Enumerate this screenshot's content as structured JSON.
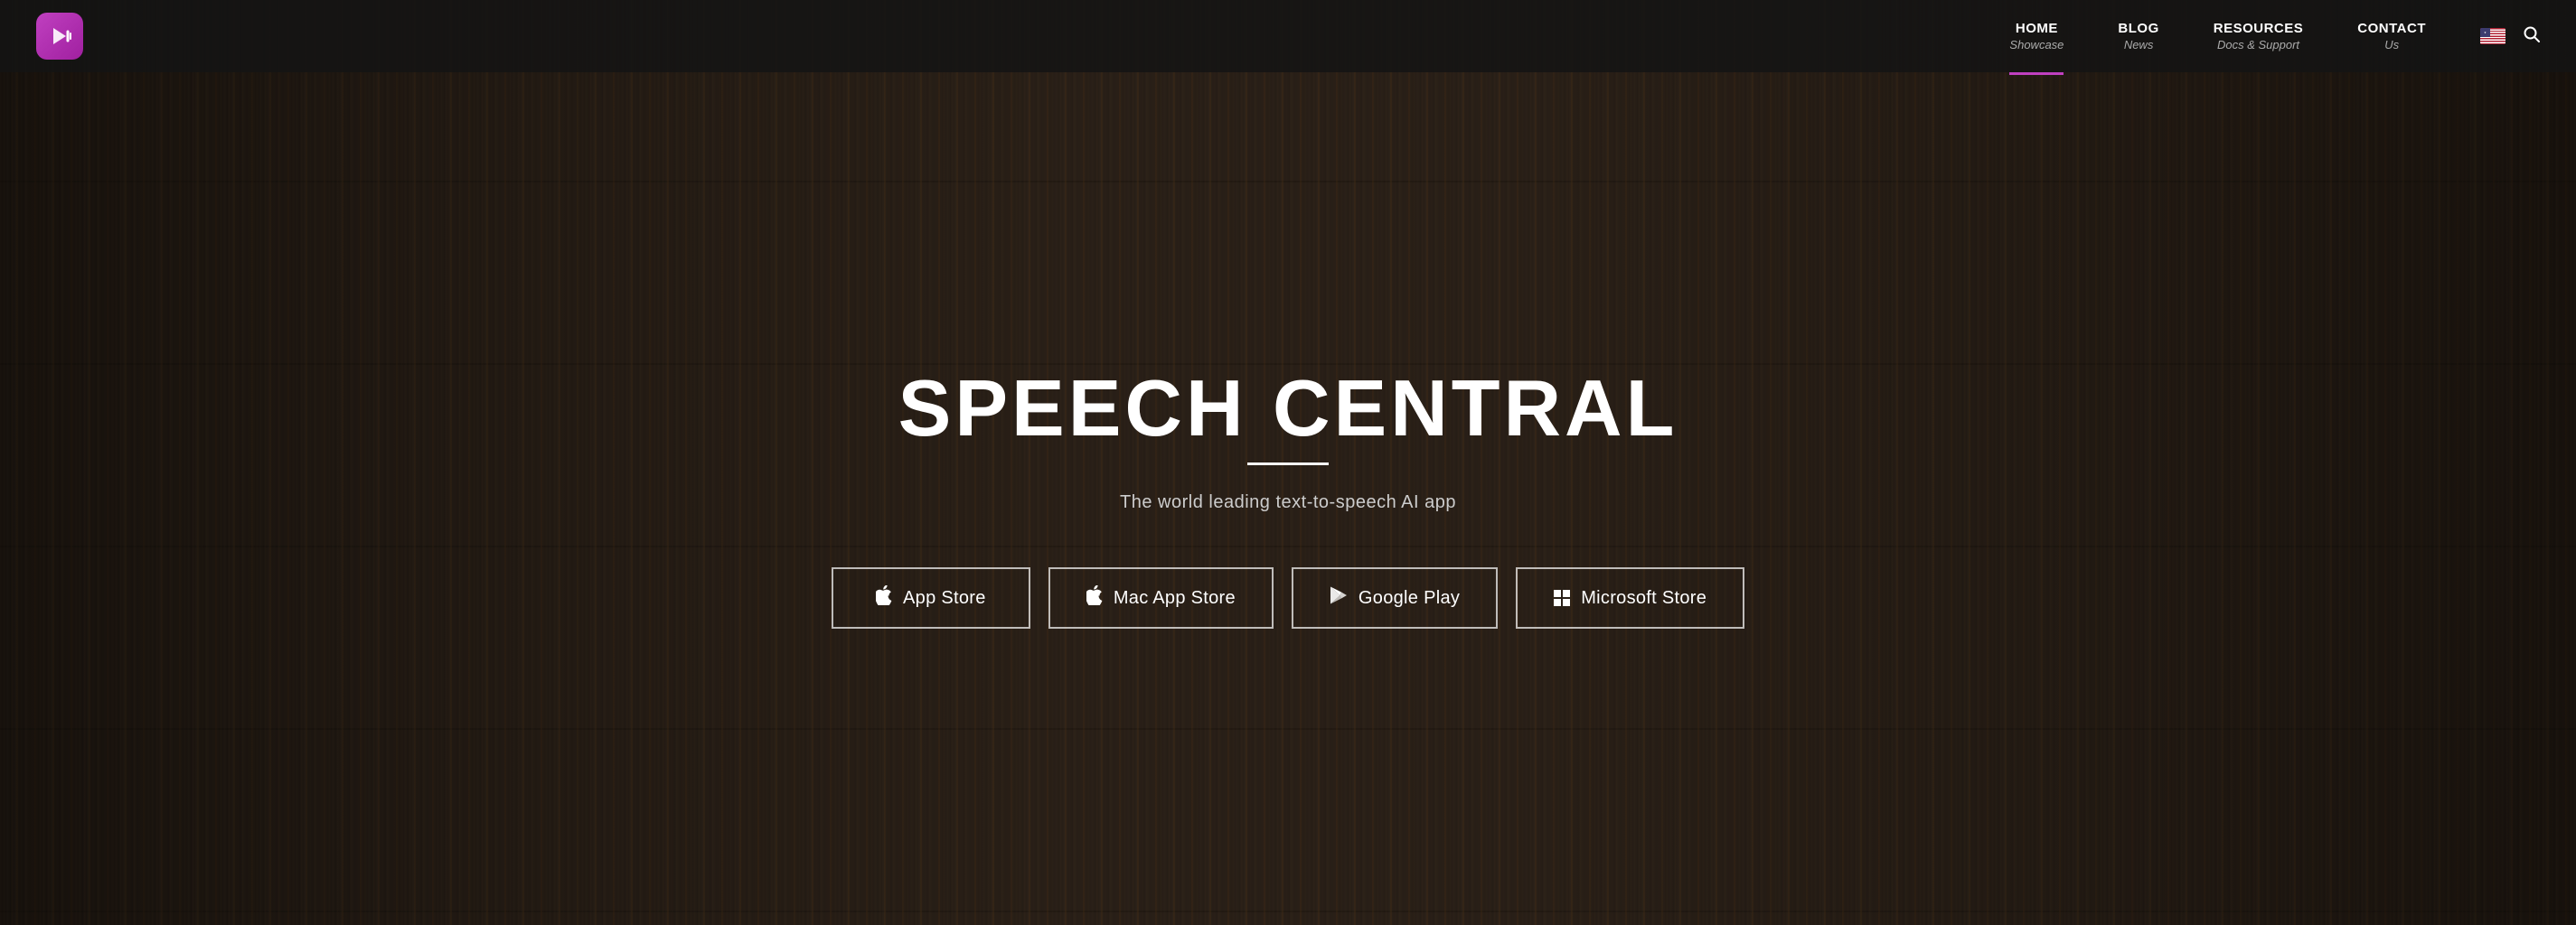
{
  "brand": {
    "name": "Speech Central",
    "logo_symbol": "🎙"
  },
  "navbar": {
    "items": [
      {
        "id": "home",
        "label": "HOME",
        "sublabel": "Showcase",
        "active": true
      },
      {
        "id": "blog",
        "label": "BLOG",
        "sublabel": "News",
        "active": false
      },
      {
        "id": "resources",
        "label": "RESOURCES",
        "sublabel": "Docs & Support",
        "active": false
      },
      {
        "id": "contact",
        "label": "CONTACT",
        "sublabel": "Us",
        "active": false
      }
    ]
  },
  "hero": {
    "title": "SPEECH CENTRAL",
    "subtitle": "The world leading text-to-speech AI app",
    "buttons": [
      {
        "id": "appstore",
        "label": "App Store",
        "icon": "apple"
      },
      {
        "id": "macappstore",
        "label": "Mac App Store",
        "icon": "apple"
      },
      {
        "id": "googleplay",
        "label": "Google Play",
        "icon": "google"
      },
      {
        "id": "microsoft",
        "label": "Microsoft Store",
        "icon": "windows"
      }
    ]
  }
}
